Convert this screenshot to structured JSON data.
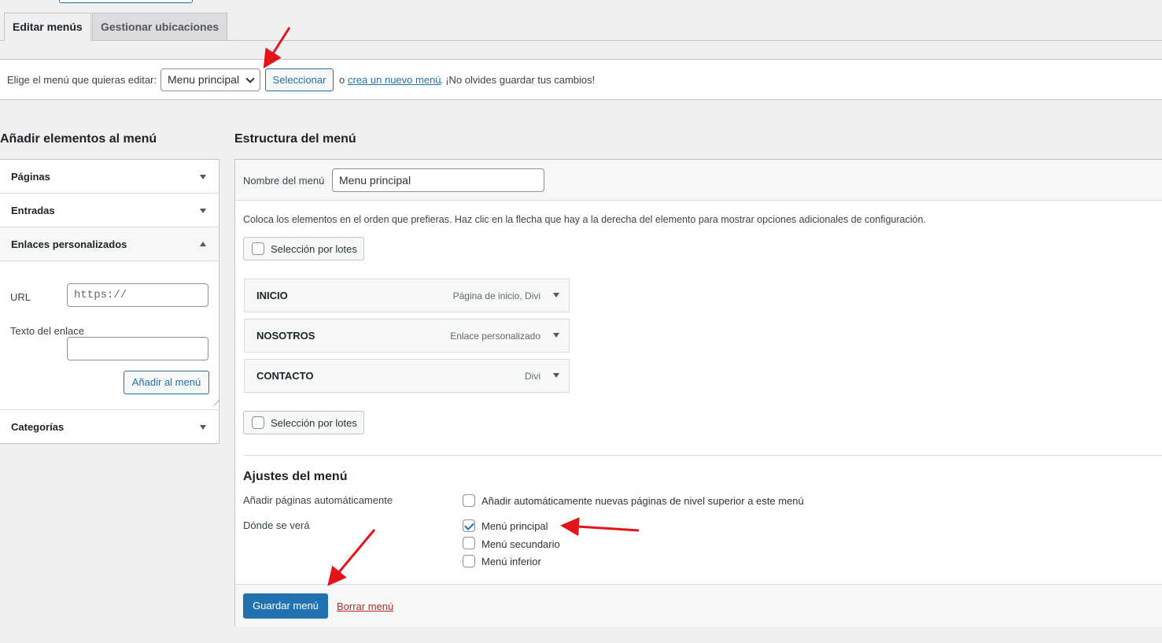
{
  "tabs": [
    {
      "label": "Editar menús",
      "active": true
    },
    {
      "label": "Gestionar ubicaciones",
      "active": false
    }
  ],
  "manage": {
    "label": "Elige el menú que quieras editar:",
    "selected_menu": "Menu principal",
    "select_button": "Seleccionar",
    "or_text": "o",
    "create_link": "crea un nuevo menú",
    "reminder": ". ¡No olvides guardar tus cambios!"
  },
  "left": {
    "title": "Añadir elementos al menú",
    "sections": [
      "Páginas",
      "Entradas",
      "Enlaces personalizados",
      "Categorías"
    ],
    "url_label": "URL",
    "url_placeholder": "https://",
    "link_text_label": "Texto del enlace",
    "add_button": "Añadir al menú"
  },
  "structure": {
    "title": "Estructura del menú",
    "name_label": "Nombre del menú",
    "name_value": "Menu principal",
    "instructions": "Coloca los elementos en el orden que prefieras. Haz clic en la flecha que hay a la derecha del elemento para mostrar opciones adicionales de configuración.",
    "bulk_label": "Selección por lotes",
    "items": [
      {
        "title": "INICIO",
        "type": "Página de inicio, Divi"
      },
      {
        "title": "NOSOTROS",
        "type": "Enlace personalizado"
      },
      {
        "title": "CONTACTO",
        "type": "Divi"
      }
    ]
  },
  "settings": {
    "title": "Ajustes del menú",
    "auto_add_label": "Añadir páginas automáticamente",
    "auto_add_option": "Añadir automáticamente nuevas páginas de nivel superior a este menú",
    "auto_add_checked": false,
    "display_label": "Dónde se verá",
    "locations": [
      {
        "label": "Menú principal",
        "checked": true
      },
      {
        "label": "Menú secundario",
        "checked": false
      },
      {
        "label": "Menú inferior",
        "checked": false
      }
    ]
  },
  "footer": {
    "save_button": "Guardar menú",
    "delete_link": "Borrar menú"
  },
  "colors": {
    "accent": "#2271b1",
    "danger": "#b32d2e",
    "annotation_arrow": "#e3151b"
  }
}
